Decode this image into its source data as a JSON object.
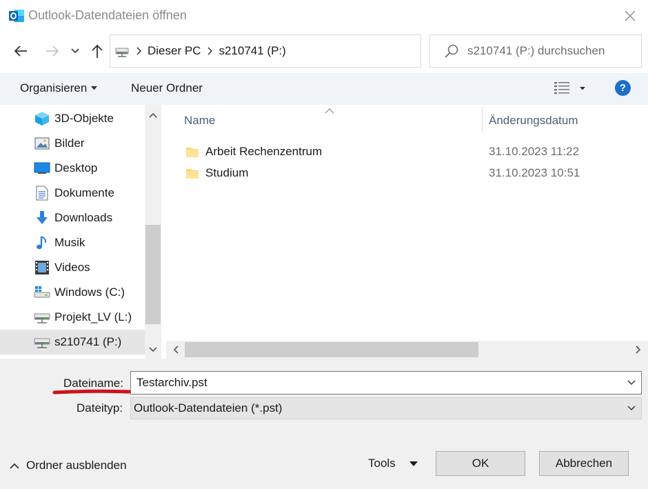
{
  "window": {
    "title": "Outlook-Datendateien öffnen"
  },
  "address": {
    "crumbs": [
      "Dieser PC",
      "s210741 (P:)"
    ]
  },
  "search": {
    "placeholder": "s210741 (P:) durchsuchen"
  },
  "toolbar": {
    "organize_label": "Organisieren",
    "new_folder_label": "Neuer Ordner",
    "help_label": "?"
  },
  "navpane": {
    "items": [
      {
        "label": "3D-Objekte",
        "icon": "3d-objects-icon"
      },
      {
        "label": "Bilder",
        "icon": "pictures-icon"
      },
      {
        "label": "Desktop",
        "icon": "desktop-icon"
      },
      {
        "label": "Dokumente",
        "icon": "documents-icon"
      },
      {
        "label": "Downloads",
        "icon": "downloads-icon"
      },
      {
        "label": "Musik",
        "icon": "music-icon"
      },
      {
        "label": "Videos",
        "icon": "videos-icon"
      },
      {
        "label": "Windows (C:)",
        "icon": "windows-drive-icon"
      },
      {
        "label": "Projekt_LV (L:)",
        "icon": "network-drive-icon"
      },
      {
        "label": "s210741 (P:)",
        "icon": "network-drive-icon",
        "selected": true
      }
    ]
  },
  "filelist": {
    "columns": {
      "name": "Name",
      "date": "Änderungsdatum"
    },
    "rows": [
      {
        "name": "Arbeit Rechenzentrum",
        "date": "31.10.2023 11:22",
        "icon": "folder-icon"
      },
      {
        "name": "Studium",
        "date": "31.10.2023 10:51",
        "icon": "folder-icon"
      }
    ]
  },
  "bottom": {
    "filename_label": "Dateiname:",
    "filename_value": "Testarchiv.pst",
    "filetype_label": "Dateityp:",
    "filetype_value": "Outlook-Datendateien (*.pst)",
    "hide_folders_label": "Ordner ausblenden",
    "tools_label": "Tools",
    "ok_label": "OK",
    "cancel_label": "Abbrechen"
  },
  "colors": {
    "accent": "#1e6fc8",
    "annotation": "#d0101c",
    "toolbar_bg": "#f0f4f9"
  }
}
